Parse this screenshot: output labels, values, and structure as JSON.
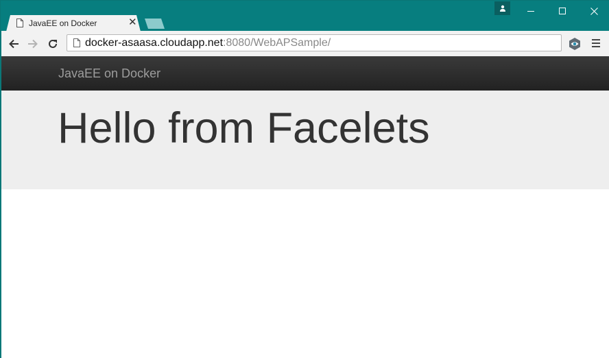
{
  "browser": {
    "tab": {
      "title": "JavaEE on Docker",
      "close_glyph": "✕"
    },
    "address": {
      "host": "docker-asaasa.cloudapp.net",
      "rest": ":8080/WebAPSample/"
    }
  },
  "page": {
    "brand": "JavaEE on Docker",
    "heading": "Hello from Facelets"
  },
  "icons": {
    "tab_favicon": "page-icon",
    "back": "arrow-left-icon",
    "forward": "arrow-right-icon",
    "reload": "reload-icon",
    "extension": "eye-icon",
    "menu": "hamburger-menu-icon",
    "profile": "person-icon"
  },
  "colors": {
    "chrome_frame": "#077e7f",
    "navbar": "#222222",
    "brand_text": "#9d9d9d",
    "jumbotron": "#eeeeee",
    "heading_text": "#333333"
  }
}
